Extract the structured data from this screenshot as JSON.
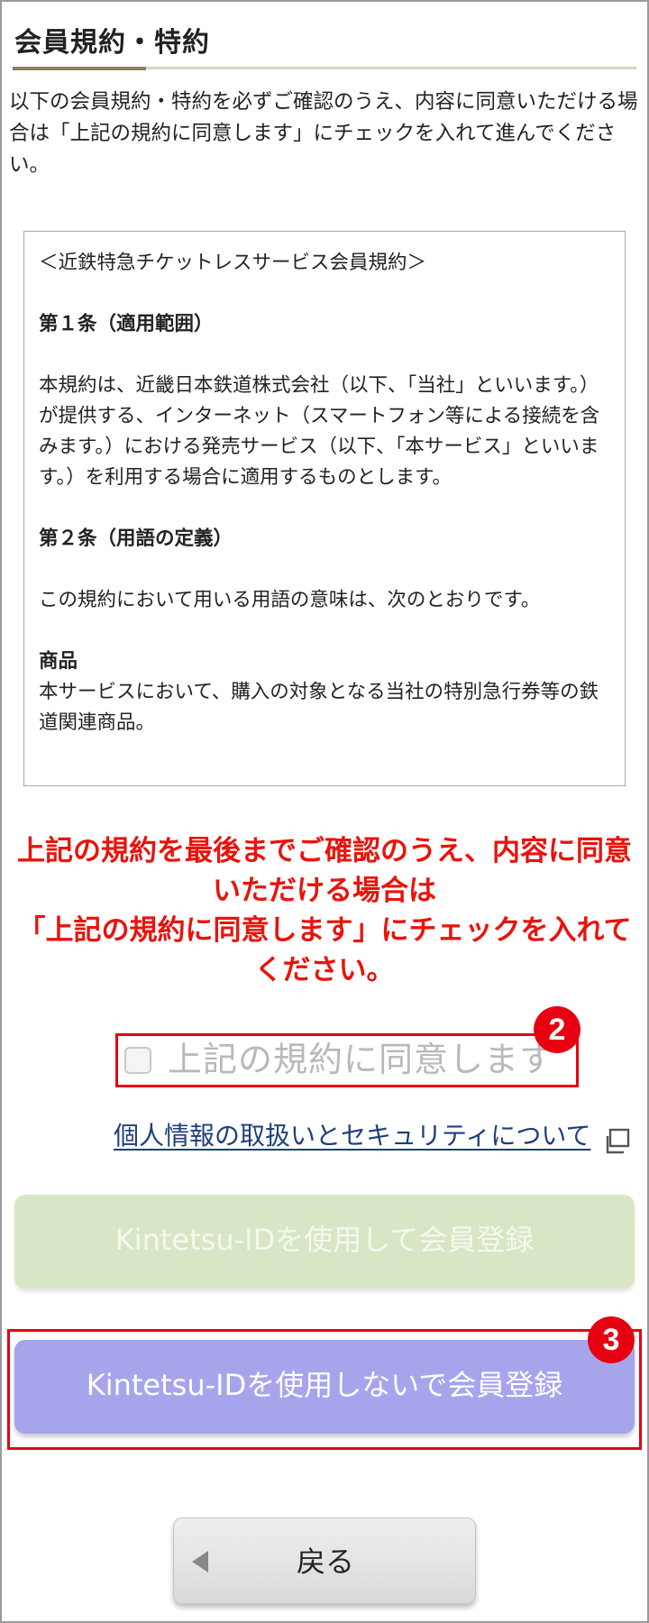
{
  "header": {
    "title": "会員規約・特約"
  },
  "intro": "以下の会員規約・特約を必ずご確認のうえ、内容に同意いただける場合は「上記の規約に同意します」にチェックを入れて進んでください。",
  "terms": {
    "heading": "＜近鉄特急チケットレスサービス会員規約＞",
    "article1_title": "第１条（適用範囲）",
    "article1_body": "本規約は、近畿日本鉄道株式会社（以下、「当社」といいます。）が提供する、インターネット（スマートフォン等による接続を含みます。）における発売サービス（以下、「本サービス」といいます。）を利用する場合に適用するものとします。",
    "article2_title": "第２条（用語の定義）",
    "article2_body": "この規約において用いる用語の意味は、次のとおりです。",
    "item_name": "商品",
    "item_body": "本サービスにおいて、購入の対象となる当社の特別急行券等の鉄道関連商品。"
  },
  "notice": {
    "line1": "上記の規約を最後までご確認のうえ、内容に同意",
    "line2": "いただける場合は",
    "line3": "「上記の規約に同意します」にチェックを入れて",
    "line4": "ください。"
  },
  "agree": {
    "label": "上記の規約に同意します",
    "checked": false
  },
  "callouts": {
    "agree": "2",
    "register_without_id": "3"
  },
  "privacy_link": "個人情報の取扱いとセキュリティについて",
  "buttons": {
    "with_id": "Kintetsu-IDを使用して会員登録",
    "without_id": "Kintetsu-IDを使用しないで会員登録",
    "back": "戻る"
  },
  "colors": {
    "accent_red": "#e60012",
    "notice_red": "#e8140c",
    "link_blue": "#1e3f7a",
    "btn_disabled_green": "#d8e6c5",
    "btn_purple": "#a6a5ec"
  },
  "icons": {
    "external": "external-link-icon",
    "back": "triangle-left-icon"
  }
}
